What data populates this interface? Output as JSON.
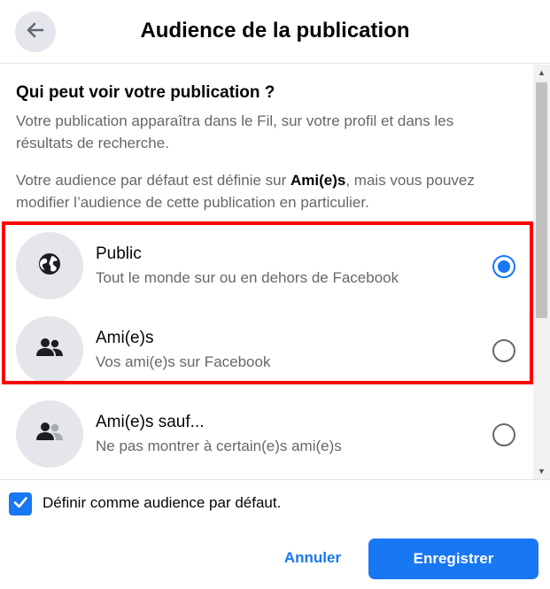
{
  "header": {
    "title": "Audience de la publication",
    "back_icon": "arrow-left-icon"
  },
  "intro": {
    "question": "Qui peut voir votre publication ?",
    "description": "Votre publication apparaîtra dans le Fil, sur votre profil et dans les résultats de recherche.",
    "default_prefix": "Votre audience par défaut est définie sur ",
    "default_value": "Ami(e)s",
    "default_suffix": ", mais vous pouvez modifier l’audience de cette publication en particulier."
  },
  "options": [
    {
      "label": "Public",
      "sublabel": "Tout le monde sur ou en dehors de Facebook",
      "icon": "globe-icon",
      "selected": true
    },
    {
      "label": "Ami(e)s",
      "sublabel": "Vos ami(e)s sur Facebook",
      "icon": "friends-icon",
      "selected": false
    },
    {
      "label": "Ami(e)s sauf...",
      "sublabel": "Ne pas montrer à certain(e)s ami(e)s",
      "icon": "friends-except-icon",
      "selected": false
    }
  ],
  "footer": {
    "default_checkbox_label": "Définir comme audience par défaut.",
    "default_checkbox_checked": true,
    "cancel_label": "Annuler",
    "save_label": "Enregistrer"
  },
  "colors": {
    "accent": "#1877f2",
    "icon_bg": "#e4e6eb",
    "secondary_text": "#65676b",
    "highlight": "#ff0000"
  }
}
